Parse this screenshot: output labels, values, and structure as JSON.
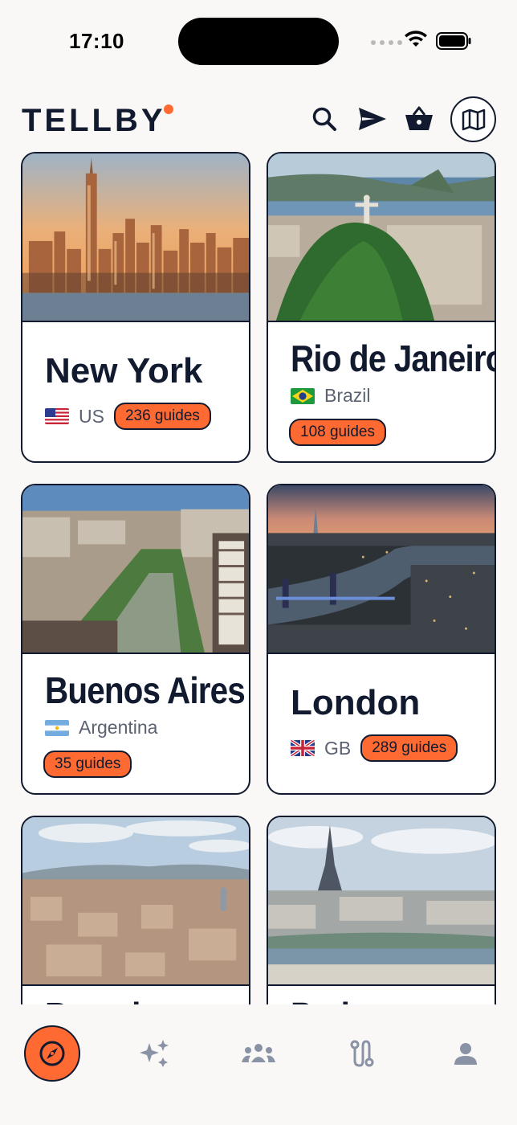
{
  "status_bar": {
    "time": "17:10"
  },
  "header": {
    "logo": "TELLBY",
    "icons": [
      "search-icon",
      "send-icon",
      "basket-icon",
      "map-icon"
    ]
  },
  "colors": {
    "accent": "#ff6a33",
    "ink": "#111a2e",
    "muted": "#5b6272",
    "tab_inactive": "#8a92a6"
  },
  "destinations": [
    {
      "city": "New York",
      "country": "US",
      "flag": "us",
      "guides": "236 guides"
    },
    {
      "city": "Rio de Janeiro",
      "country": "Brazil",
      "flag": "br",
      "guides": "108 guides"
    },
    {
      "city": "Buenos Aires",
      "country": "Argentina",
      "flag": "ar",
      "guides": "35 guides"
    },
    {
      "city": "London",
      "country": "GB",
      "flag": "gb",
      "guides": "289 guides"
    },
    {
      "city": "Barcelona",
      "country": "",
      "flag": "",
      "guides": ""
    },
    {
      "city": "Paris",
      "country": "",
      "flag": "",
      "guides": ""
    }
  ],
  "tabs": [
    {
      "icon": "compass-icon",
      "active": true
    },
    {
      "icon": "sparkles-icon",
      "active": false
    },
    {
      "icon": "community-icon",
      "active": false
    },
    {
      "icon": "route-icon",
      "active": false
    },
    {
      "icon": "profile-icon",
      "active": false
    }
  ]
}
